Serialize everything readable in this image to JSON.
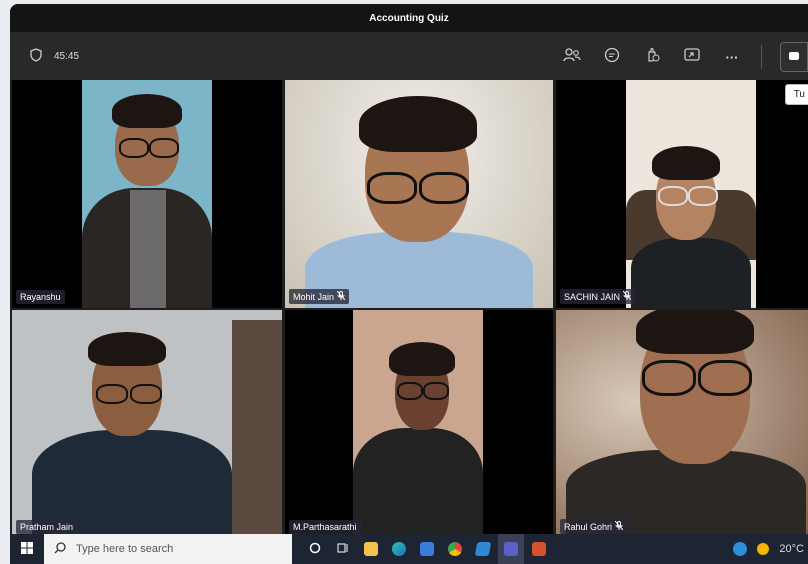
{
  "window": {
    "title": "Accounting Quiz"
  },
  "toolbar": {
    "timer": "45:45",
    "icons": [
      "people-icon",
      "chat-icon",
      "reactions-icon",
      "share-icon",
      "more-icon"
    ],
    "more_label": "···",
    "tooltip": "Tu"
  },
  "participants": [
    {
      "name": "Rayanshu",
      "mic": false,
      "bg": "#7ab3c4"
    },
    {
      "name": "Mohit Jain",
      "mic": true,
      "bg": "#d8d2c6"
    },
    {
      "name": "SACHIN JAIN",
      "mic": true,
      "bg": "#e8e2d8"
    },
    {
      "name": "Pratham Jain",
      "mic": false,
      "bg": "#bfc3c6"
    },
    {
      "name": "M.Parthasarathi",
      "mic": false,
      "bg": "#c7a28e"
    },
    {
      "name": "Rahul Gohri",
      "mic": true,
      "bg": "#9c7a5e"
    }
  ],
  "taskbar": {
    "search_placeholder": "Type here to search",
    "weather": "20°C",
    "apps": [
      "cortana-icon",
      "task-view-icon",
      "file-explorer-icon",
      "edge-icon",
      "store-icon",
      "chrome-icon",
      "photos-icon",
      "teams-icon",
      "powerpoint-icon"
    ]
  },
  "colors": {
    "titlebar": "#141414",
    "toolbar": "#292929",
    "taskbar": "#1d2432"
  }
}
